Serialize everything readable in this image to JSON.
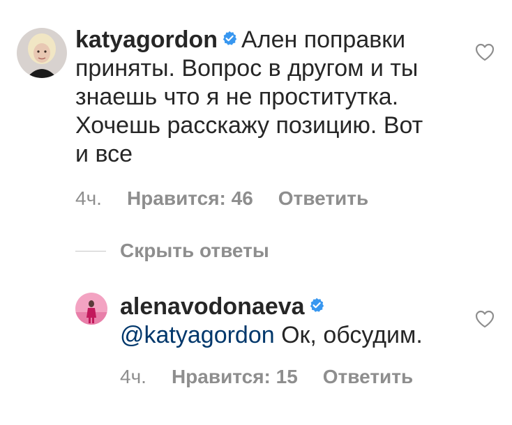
{
  "comments": [
    {
      "username": "katyagordon",
      "verified": true,
      "text": "Ален поправки приняты. Вопрос в другом и ты знаешь что я не проститутка. Хочешь расскажу позицию. Вот и все",
      "time": "4ч.",
      "likes_label": "Нравится: 46",
      "reply_label": "Ответить",
      "like_icon": "heart-outline-icon"
    }
  ],
  "hide_replies": {
    "label": "Скрыть ответы"
  },
  "replies": [
    {
      "username": "alenavodonaeva",
      "verified": true,
      "mention": "@katyagordon",
      "text": "Ок, обсудим.",
      "time": "4ч.",
      "likes_label": "Нравится: 15",
      "reply_label": "Ответить",
      "like_icon": "heart-outline-icon"
    }
  ],
  "colors": {
    "text": "#262626",
    "secondary": "#8e8e8e",
    "mention": "#00376b",
    "verified_badge": "#3897f0"
  }
}
